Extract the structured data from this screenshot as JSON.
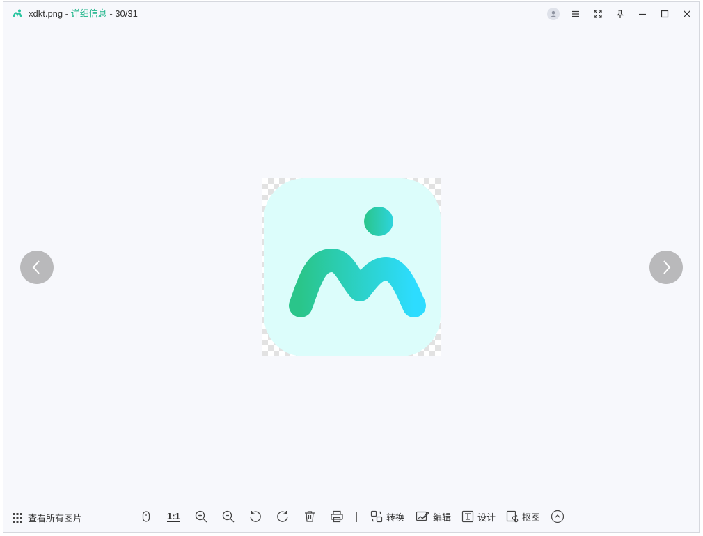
{
  "window": {
    "filename": "xdkt.png",
    "separator": " - ",
    "detail_link": "详细信息",
    "separator2": " - ",
    "position": "30/31",
    "buttons": [
      "user-icon",
      "menu-icon",
      "fullscreen-icon",
      "pin-icon",
      "minimize-icon",
      "maximize-icon",
      "close-icon"
    ]
  },
  "viewer": {
    "image_icons": [
      "checkerboard-transparency",
      "app-logo-image"
    ],
    "prev_icon": "chevron-left-icon",
    "next_icon": "chevron-right-icon"
  },
  "toolbar": {
    "all_pictures_label": "查看所有图片",
    "actual_size_label": "1:1",
    "convert_label": "转换",
    "edit_label": "编辑",
    "design_label": "设计",
    "cutout_label": "抠图",
    "icons": [
      "grid-icon",
      "mouse-icon",
      "zoom-in-icon",
      "zoom-out-icon",
      "rotate-left-icon",
      "rotate-right-icon",
      "delete-icon",
      "print-icon",
      "convert-icon",
      "edit-icon",
      "design-icon",
      "cutout-icon",
      "expand-up-icon"
    ]
  },
  "colors": {
    "accent": "#1fb58a",
    "logo_bg": "#dcfdfb",
    "logo_green": "#2ac58a",
    "logo_cyan": "#2ddcff",
    "nav_button": "#b9b9bb"
  }
}
